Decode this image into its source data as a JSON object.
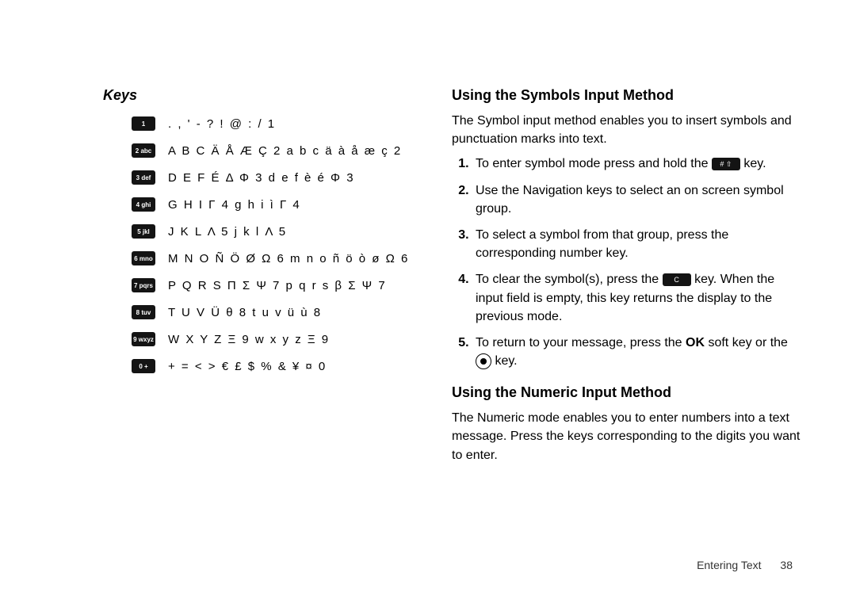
{
  "left": {
    "heading": "Keys",
    "rows": [
      {
        "keyLabel": "1",
        "chars": ". , ' - ? ! @ : / 1"
      },
      {
        "keyLabel": "2 abc",
        "chars": "A B C Ä Å Æ Ç 2 a b c ä à å æ ç 2"
      },
      {
        "keyLabel": "3 def",
        "chars": "D E F É Δ Φ 3 d e f è é Φ 3"
      },
      {
        "keyLabel": "4 ghi",
        "chars": "G H I Γ 4 g h i ì Γ 4"
      },
      {
        "keyLabel": "5 jkl",
        "chars": "J K L Λ 5 j k l Λ 5"
      },
      {
        "keyLabel": "6 mno",
        "chars": "M N O Ñ Ö Ø Ω 6 m n o ñ ö ò ø Ω 6"
      },
      {
        "keyLabel": "7 pqrs",
        "chars": "P Q R S Π Σ Ψ 7 p q r s β Σ Ψ 7"
      },
      {
        "keyLabel": "8 tuv",
        "chars": "T U V Ü θ 8 t u v ü ù 8"
      },
      {
        "keyLabel": "9 wxyz",
        "chars": "W X Y Z Ξ 9 w x y z Ξ 9"
      },
      {
        "keyLabel": "0 +",
        "chars": "+ = < > € £ $ % & ¥ ¤ 0"
      }
    ]
  },
  "right": {
    "symbols": {
      "heading": "Using the Symbols Input Method",
      "intro": "The Symbol input method enables you to insert symbols and punctuation marks into text.",
      "step1_a": "To enter symbol mode press and hold the ",
      "step1_key": "# ⇧",
      "step1_b": " key.",
      "step2": "Use the Navigation keys to select an on screen symbol group.",
      "step3": "To select a symbol from that group, press the corresponding number key.",
      "step4_a": "To clear the symbol(s), press the ",
      "step4_key": "C",
      "step4_b": " key. When the input field is empty, this key returns the display to the previous mode.",
      "step5_a": "To return to your message, press the ",
      "step5_ok": "OK",
      "step5_b": " soft key or the ",
      "step5_c": " key."
    },
    "numeric": {
      "heading": "Using the Numeric Input Method",
      "body": "The Numeric mode enables you to enter numbers into a text message. Press the keys corresponding to the digits you want to enter."
    }
  },
  "footer": {
    "section": "Entering Text",
    "page": "38"
  }
}
